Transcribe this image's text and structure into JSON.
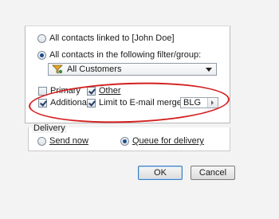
{
  "contacts": {
    "option_linked": "All contacts linked to [John Doe]",
    "option_filter": "All contacts in the following filter/group:",
    "filter_selected": "All Customers"
  },
  "checkboxes": {
    "primary": "Primary",
    "other": "Other",
    "additional": "Additional",
    "limit": "Limit to E-mail merge code:",
    "merge_code": "BLG"
  },
  "delivery": {
    "title": "Delivery",
    "send_now": "Send now",
    "queue": "Queue for delivery"
  },
  "buttons": {
    "ok": "OK",
    "cancel": "Cancel"
  },
  "colors": {
    "highlight_ellipse": "#d32020",
    "dialog_bg": "#f3f3f3"
  }
}
